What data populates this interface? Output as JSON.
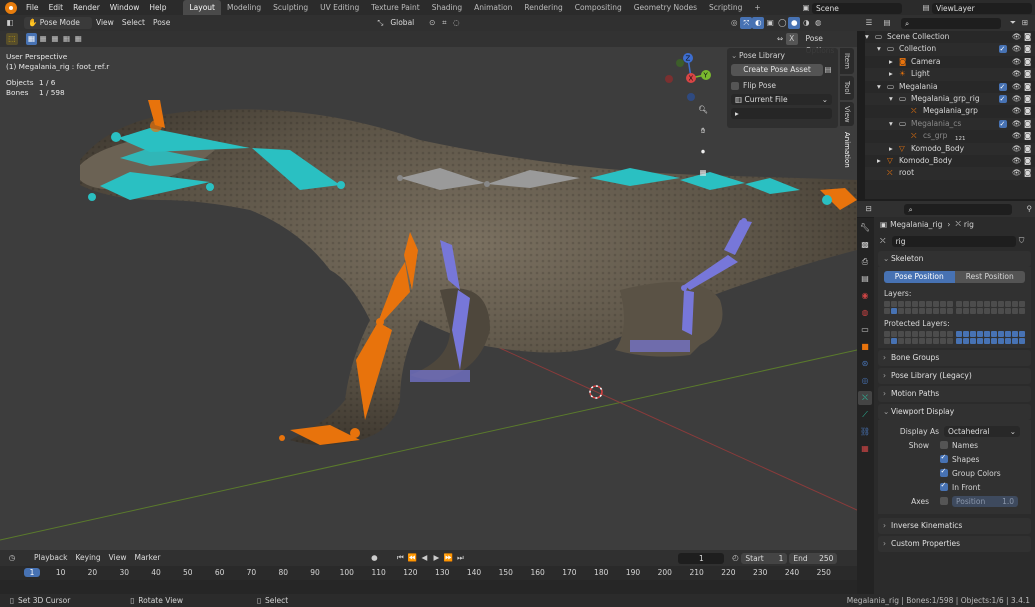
{
  "topbar": {
    "menus": [
      "File",
      "Edit",
      "Render",
      "Window",
      "Help"
    ],
    "workspaces": [
      "Layout",
      "Modeling",
      "Sculpting",
      "UV Editing",
      "Texture Paint",
      "Shading",
      "Animation",
      "Rendering",
      "Compositing",
      "Geometry Nodes",
      "Scripting"
    ],
    "active_workspace": "Layout",
    "add_tab": "+",
    "scene_label": "Scene",
    "viewlayer_label": "ViewLayer"
  },
  "viewport_header": {
    "mode": "Pose Mode",
    "menus": [
      "View",
      "Select",
      "Pose"
    ],
    "orientation": "Global",
    "pose_options": "Pose Options"
  },
  "viewport_info": {
    "view": "User Perspective",
    "object": "(1) Megalania_rig : foot_ref.r",
    "objects_label": "Objects",
    "objects_value": "1 / 6",
    "bones_label": "Bones",
    "bones_value": "1 / 598"
  },
  "npanel": {
    "title": "Pose Library",
    "create_button": "Create Pose Asset",
    "flip_label": "Flip Pose",
    "library_value": "Current File",
    "tabs": [
      "Item",
      "Tool",
      "View",
      "Animation"
    ],
    "active_tab": "Animation"
  },
  "gizmo": {
    "z": "Z",
    "y": "Y",
    "x": "X"
  },
  "timeline": {
    "menus": [
      "Playback",
      "Keying",
      "View",
      "Marker"
    ],
    "current_frame": "1",
    "start_label": "Start",
    "start_value": "1",
    "end_label": "End",
    "end_value": "250",
    "ticks": [
      "1",
      "10",
      "20",
      "30",
      "40",
      "50",
      "60",
      "70",
      "80",
      "90",
      "100",
      "110",
      "120",
      "130",
      "140",
      "150",
      "160",
      "170",
      "180",
      "190",
      "200",
      "210",
      "220",
      "230",
      "240",
      "250"
    ]
  },
  "statusbar": {
    "hint1": "Set 3D Cursor",
    "hint2": "Rotate View",
    "hint3": "Select",
    "stats": "Megalania_rig | Bones:1/598 | Objects:1/6 | 3.4.1"
  },
  "outliner": {
    "rows": [
      {
        "label": "Scene Collection",
        "indent": 0,
        "icon": "collection-icon",
        "checkbox": false
      },
      {
        "label": "Collection",
        "indent": 1,
        "icon": "collection-icon",
        "checkbox": true
      },
      {
        "label": "Camera",
        "indent": 2,
        "icon": "camera-icon",
        "checkbox": false
      },
      {
        "label": "Light",
        "indent": 2,
        "icon": "light-icon",
        "checkbox": false
      },
      {
        "label": "Megalania",
        "indent": 1,
        "icon": "collection-icon",
        "checkbox": true
      },
      {
        "label": "Megalania_grp_rig",
        "indent": 2,
        "icon": "collection-icon",
        "checkbox": true
      },
      {
        "label": "Megalania_grp",
        "indent": 3,
        "icon": "armature-icon",
        "checkbox": false
      },
      {
        "label": "Megalania_cs",
        "indent": 2,
        "icon": "collection-icon",
        "checkbox": true
      },
      {
        "label": "cs_grp",
        "indent": 3,
        "icon": "armature-icon",
        "checkbox": false,
        "badge": "121"
      },
      {
        "label": "Komodo_Body",
        "indent": 2,
        "icon": "mesh-icon",
        "checkbox": false
      },
      {
        "label": "Komodo_Body",
        "indent": 1,
        "icon": "mesh-icon",
        "checkbox": false
      },
      {
        "label": "root",
        "indent": 1,
        "icon": "armature-icon",
        "checkbox": false
      }
    ]
  },
  "properties": {
    "breadcrumb_object": "Megalania_rig",
    "breadcrumb_data": "rig",
    "datablock_name": "rig",
    "skeleton": {
      "title": "Skeleton",
      "pose_position": "Pose Position",
      "rest_position": "Rest Position",
      "layers_label": "Layers:",
      "protected_label": "Protected Layers:"
    },
    "panels": [
      "Bone Groups",
      "Pose Library (Legacy)",
      "Motion Paths"
    ],
    "viewport_display": {
      "title": "Viewport Display",
      "display_as_label": "Display As",
      "display_as_value": "Octahedral",
      "show_label": "Show",
      "names": "Names",
      "shapes": "Shapes",
      "group_colors": "Group Colors",
      "in_front": "In Front",
      "axes_label": "Axes",
      "position_label": "Position",
      "position_value": "1.0"
    },
    "bottom_panels": [
      "Inverse Kinematics",
      "Custom Properties"
    ]
  },
  "colors": {
    "accent": "#4772b3",
    "bone_orange": "#e8730c",
    "bone_teal": "#2ac0c2",
    "bone_purple": "#7777d9",
    "bone_gray": "#9a9a9a"
  }
}
